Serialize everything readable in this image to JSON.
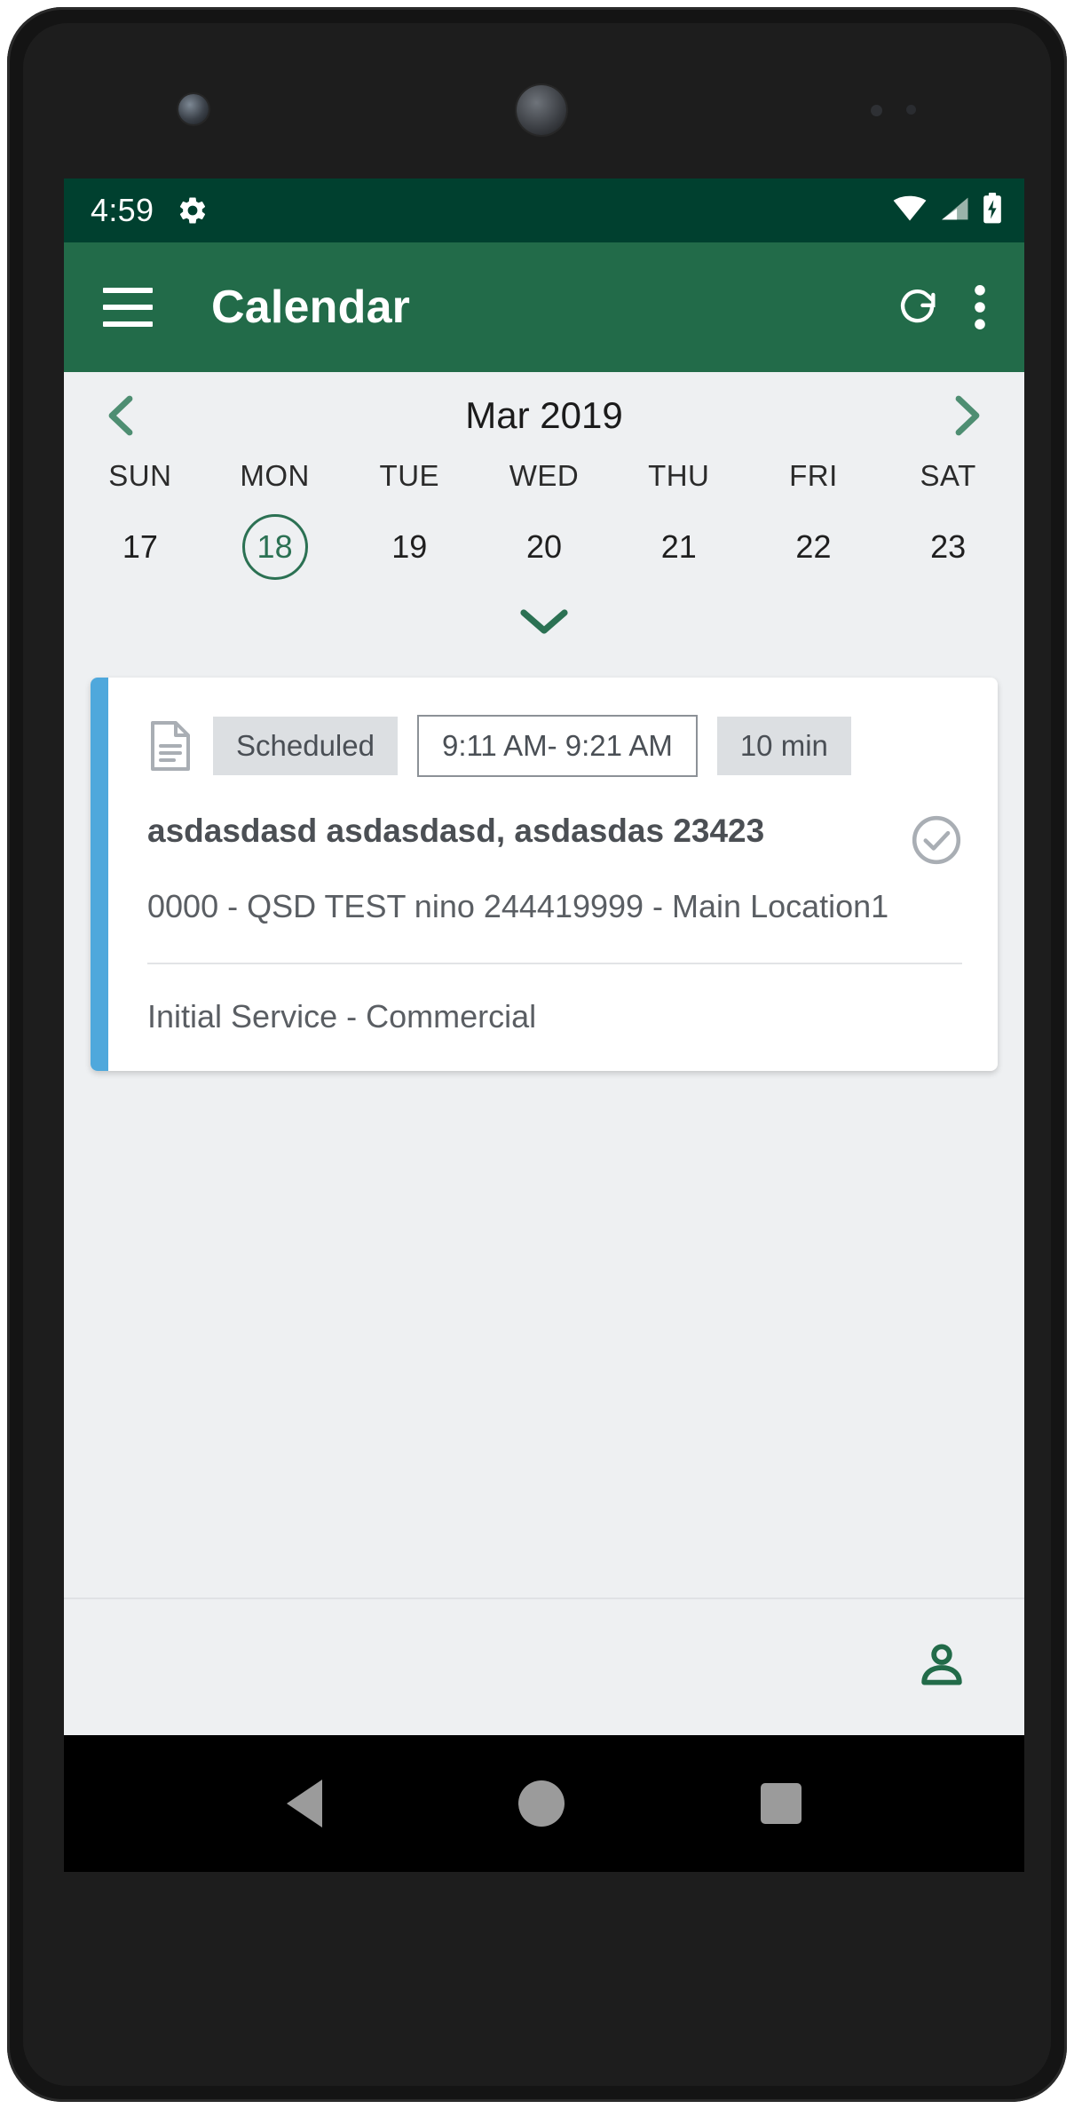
{
  "status_bar": {
    "time": "4:59",
    "gear_icon": "gear-icon",
    "wifi_icon": "wifi-icon",
    "signal_icon": "cellular-signal-icon",
    "battery_icon": "battery-charging-icon"
  },
  "app_bar": {
    "menu_icon": "hamburger-menu-icon",
    "title": "Calendar",
    "refresh_icon": "refresh-icon",
    "overflow_icon": "more-vertical-icon"
  },
  "calendar": {
    "prev_icon": "chevron-left-icon",
    "month_label": "Mar 2019",
    "next_icon": "chevron-right-icon",
    "expand_icon": "chevron-down-icon",
    "days": [
      {
        "name": "SUN",
        "number": "17",
        "selected": false
      },
      {
        "name": "MON",
        "number": "18",
        "selected": true
      },
      {
        "name": "TUE",
        "number": "19",
        "selected": false
      },
      {
        "name": "WED",
        "number": "20",
        "selected": false
      },
      {
        "name": "THU",
        "number": "21",
        "selected": false
      },
      {
        "name": "FRI",
        "number": "22",
        "selected": false
      },
      {
        "name": "SAT",
        "number": "23",
        "selected": false
      }
    ]
  },
  "event": {
    "accent_color": "#4FA8DC",
    "type_icon": "document-icon",
    "status_chip": "Scheduled",
    "time_chip": "9:11 AM- 9:21 AM",
    "duration_chip": "10 min",
    "title": "asdasdasd asdasdasd, asdasdas 23423",
    "status_icon": "check-circle-icon",
    "subtitle": "0000 - QSD TEST nino 244419999 - Main Location1",
    "service": "Initial Service - Commercial"
  },
  "bottom_bar": {
    "account_icon": "person-icon",
    "accent_color": "#226B49"
  },
  "nav_bar": {
    "back_icon": "back-triangle-icon",
    "home_icon": "home-circle-icon",
    "recents_icon": "recents-square-icon"
  },
  "theme": {
    "status_bar_color": "#00402F",
    "app_bar_color": "#226B49",
    "screen_background": "#eef0f2",
    "card_background": "#ffffff"
  }
}
